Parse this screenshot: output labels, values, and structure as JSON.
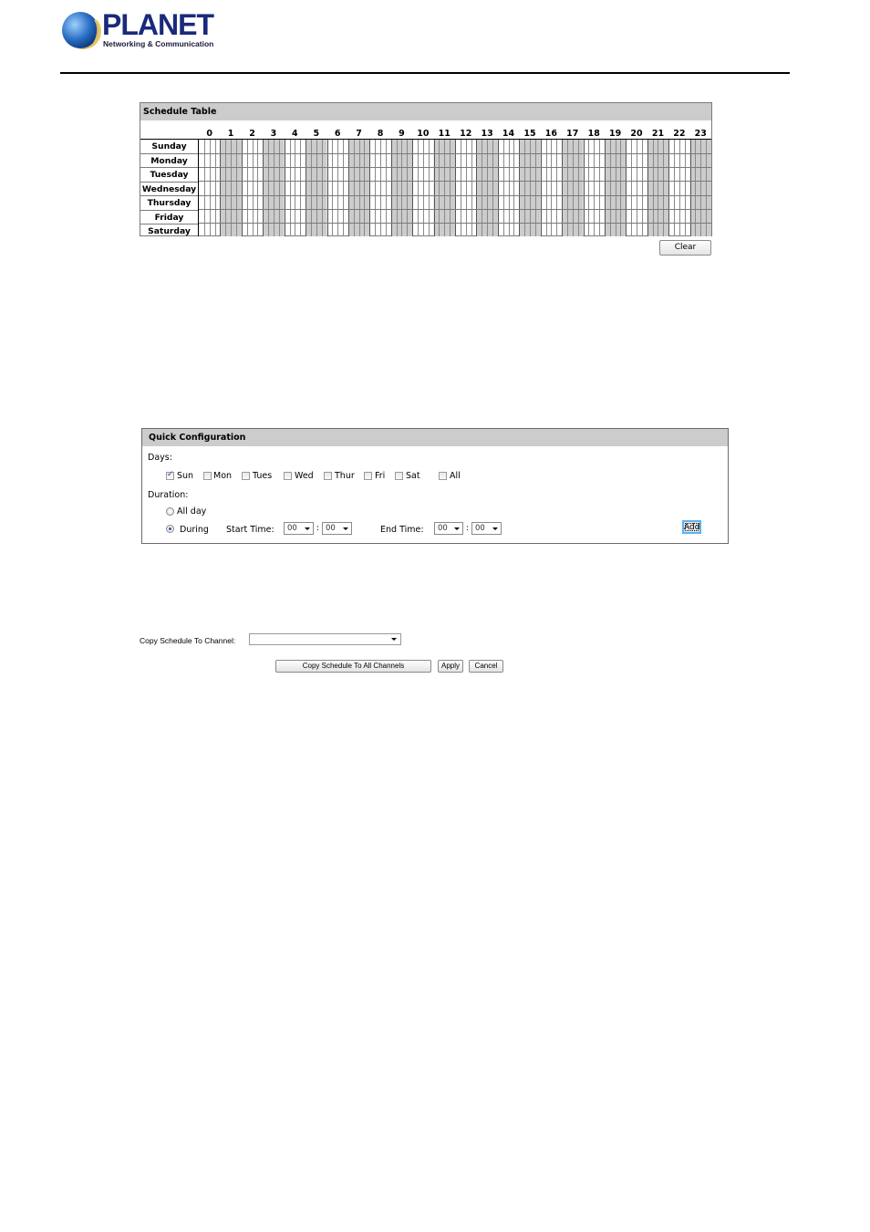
{
  "brand": {
    "name": "PLANET",
    "tagline": "Networking & Communication"
  },
  "schedule_table": {
    "title": "Schedule Table",
    "hours": [
      "0",
      "1",
      "2",
      "3",
      "4",
      "5",
      "6",
      "7",
      "8",
      "9",
      "10",
      "11",
      "12",
      "13",
      "14",
      "15",
      "16",
      "17",
      "18",
      "19",
      "20",
      "21",
      "22",
      "23"
    ],
    "days": [
      "Sunday",
      "Monday",
      "Tuesday",
      "Wednesday",
      "Thursday",
      "Friday",
      "Saturday"
    ],
    "slots_per_hour": 4,
    "selected_slots": [],
    "colors": {
      "odd_hour_shade": "#cccccc",
      "header_bg": "#cccccc"
    },
    "clear_label": "Clear"
  },
  "quick_config": {
    "title": "Quick Configuration",
    "days_label": "Days:",
    "days": [
      {
        "label": "Sun",
        "checked": true
      },
      {
        "label": "Mon",
        "checked": false
      },
      {
        "label": "Tues",
        "checked": false
      },
      {
        "label": "Wed",
        "checked": false
      },
      {
        "label": "Thur",
        "checked": false
      },
      {
        "label": "Fri",
        "checked": false
      },
      {
        "label": "Sat",
        "checked": false
      },
      {
        "label": "All",
        "checked": false
      }
    ],
    "duration_label": "Duration:",
    "options": [
      {
        "label": "All day",
        "checked": false
      },
      {
        "label": "During",
        "checked": true
      }
    ],
    "start_time_label": "Start Time:",
    "end_time_label": "End Time:",
    "start_hour": "00",
    "start_minute": "00",
    "end_hour": "00",
    "end_minute": "00",
    "colon": ":",
    "add_label": "Add"
  },
  "copy": {
    "label": "Copy Schedule To Channel:",
    "selected": "",
    "copy_all_label": "Copy Schedule To All Channels",
    "apply_label": "Apply",
    "cancel_label": "Cancel"
  }
}
